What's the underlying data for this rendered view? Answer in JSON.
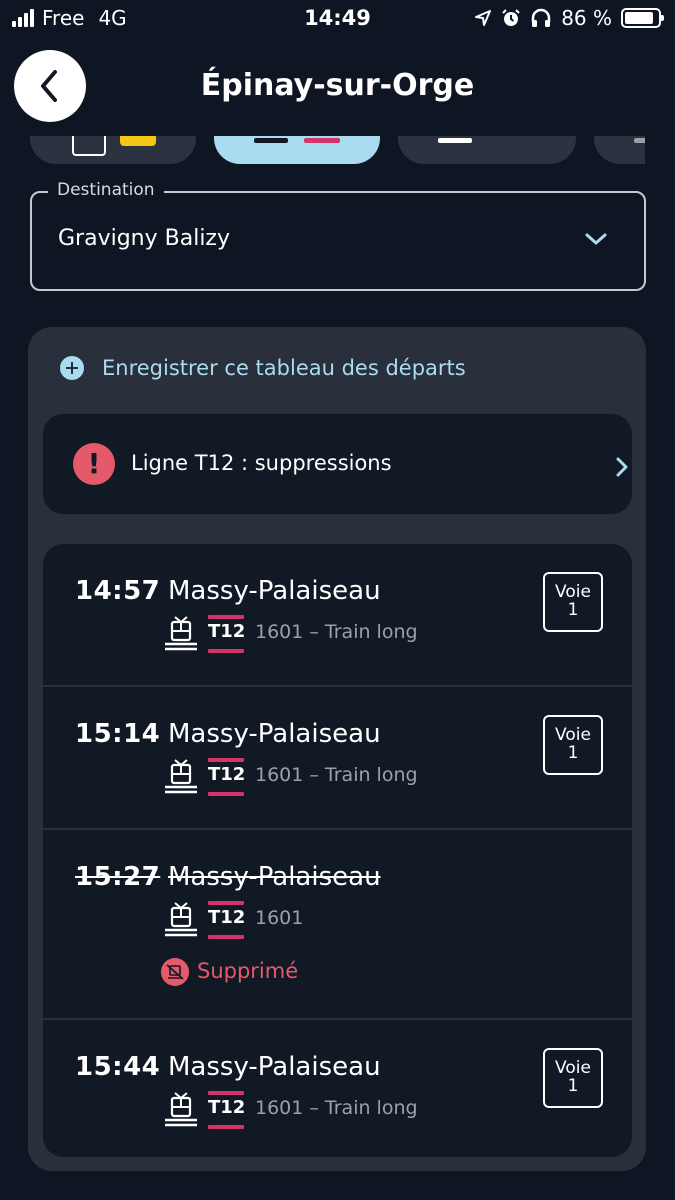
{
  "status_bar": {
    "carrier": "Free",
    "network": "4G",
    "time": "14:49",
    "battery_text": "86 %",
    "battery_level": 0.86
  },
  "header": {
    "title": "Épinay-sur-Orge",
    "back_icon": "chevron-left-icon"
  },
  "destination": {
    "legend": "Destination",
    "value": "Gravigny Balizy"
  },
  "save_board": {
    "label": "Enregistrer ce tableau des départs",
    "icon": "plus-circle-icon"
  },
  "alert": {
    "label": "Ligne T12 : suppressions",
    "icon": "exclamation-icon"
  },
  "departures": [
    {
      "time": "14:57",
      "destination": "Massy-Palaiseau",
      "line": "T12",
      "info": "1601 – Train long",
      "platform_label": "Voie",
      "platform": "1",
      "cancelled": false
    },
    {
      "time": "15:14",
      "destination": "Massy-Palaiseau",
      "line": "T12",
      "info": "1601 – Train long",
      "platform_label": "Voie",
      "platform": "1",
      "cancelled": false
    },
    {
      "time": "15:27",
      "destination": "Massy-Palaiseau",
      "line": "T12",
      "info": "1601",
      "status": "Supprimé",
      "cancelled": true
    },
    {
      "time": "15:44",
      "destination": "Massy-Palaiseau",
      "line": "T12",
      "info": "1601 – Train long",
      "platform_label": "Voie",
      "platform": "1",
      "cancelled": false
    }
  ],
  "colors": {
    "background": "#0f1623",
    "panel": "#29303c",
    "card": "#111925",
    "accent": "#a9dcf1",
    "line_t12": "#d6336c",
    "alert": "#e45a6b"
  }
}
